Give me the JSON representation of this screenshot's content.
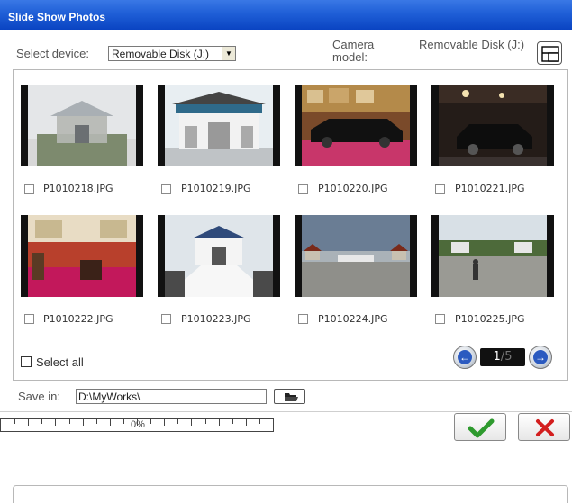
{
  "window": {
    "title": "Slide Show Photos"
  },
  "device": {
    "label": "Select device:",
    "selected": "Removable Disk (J:)",
    "camera_label": "Camera model:",
    "camera_value": "Removable Disk (J:)"
  },
  "photos": [
    {
      "file": "P1010218.JPG",
      "checked": false
    },
    {
      "file": "P1010219.JPG",
      "checked": false
    },
    {
      "file": "P1010220.JPG",
      "checked": false
    },
    {
      "file": "P1010221.JPG",
      "checked": false
    },
    {
      "file": "P1010222.JPG",
      "checked": false
    },
    {
      "file": "P1010223.JPG",
      "checked": false
    },
    {
      "file": "P1010224.JPG",
      "checked": false
    },
    {
      "file": "P1010225.JPG",
      "checked": false
    }
  ],
  "select_all": {
    "label": "Select all",
    "checked": false
  },
  "pager": {
    "current": "1",
    "separator": "/",
    "total": "5"
  },
  "save": {
    "label": "Save in:",
    "path": "D:\\MyWorks\\"
  },
  "progress": {
    "percent": 0,
    "label": "0%"
  },
  "icons": {
    "view": "view-toggle-icon",
    "folder": "folder-open-icon",
    "ok": "checkmark-icon",
    "cancel": "close-icon",
    "prev": "arrow-left-icon",
    "next": "arrow-right-icon"
  },
  "colors": {
    "title_bar": "#1f5fd7",
    "ok": "#2e9a2e",
    "cancel": "#d31e1e",
    "pager_button": "#2b5ac0"
  }
}
